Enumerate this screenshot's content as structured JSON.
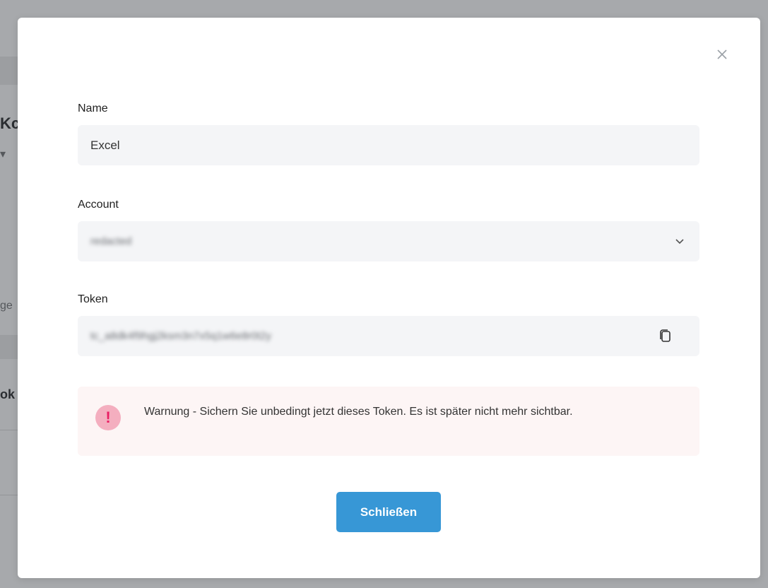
{
  "background": {
    "frag1": "Kc",
    "frag2": "ge",
    "frag3": "ok"
  },
  "modal": {
    "close_icon": "close-icon",
    "name": {
      "label": "Name",
      "value": "Excel"
    },
    "account": {
      "label": "Account",
      "value": "redacted",
      "chevron_icon": "chevron-down-icon"
    },
    "token": {
      "label": "Token",
      "value": "tc_a8dk4f9hgj2ksm3n7x5q1w6e8r0t2y",
      "copy_icon": "copy-icon"
    },
    "warning": {
      "icon": "exclamation-icon",
      "text": "Warnung - Sichern Sie unbedingt jetzt dieses Token. Es ist später nicht mehr sichtbar."
    },
    "close_button_label": "Schließen"
  },
  "colors": {
    "primary": "#3797d6",
    "warning_bg": "#fdf5f5",
    "warning_icon": "#e91e63",
    "field_bg": "#f4f5f7"
  }
}
